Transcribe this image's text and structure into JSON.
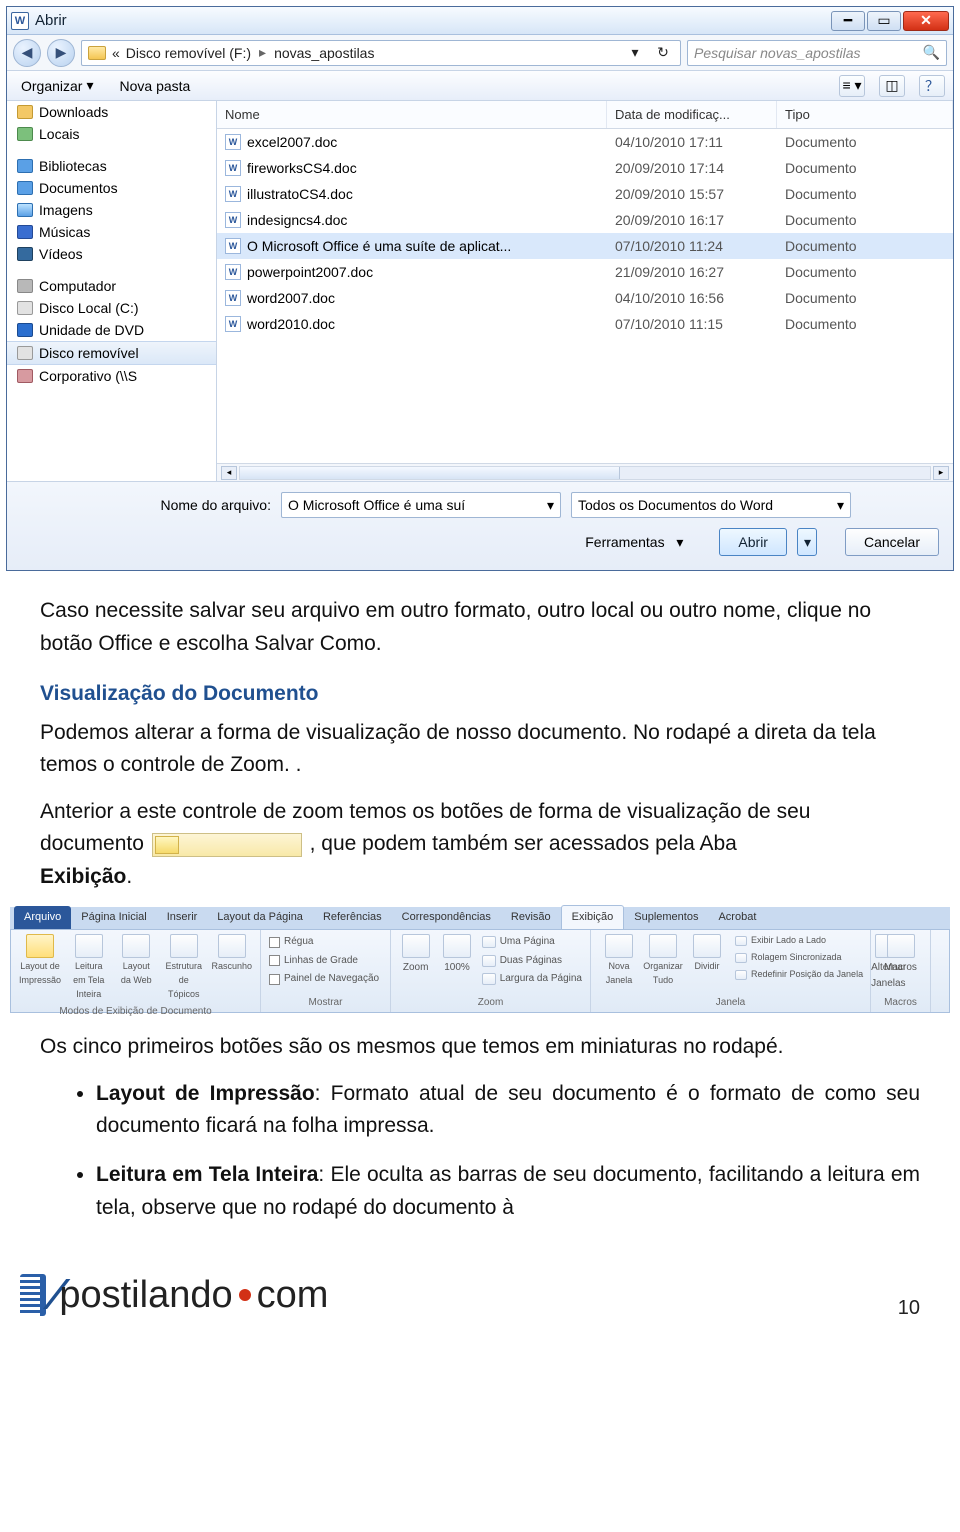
{
  "dialog": {
    "title": "Abrir",
    "breadcrumb": {
      "prefix": "«",
      "drive": "Disco removível (F:)",
      "folder": "novas_apostilas"
    },
    "search_placeholder": "Pesquisar novas_apostilas",
    "toolbar": {
      "organize": "Organizar",
      "new_folder": "Nova pasta"
    },
    "tree": [
      {
        "label": "Downloads",
        "icon": "yellow"
      },
      {
        "label": "Locais",
        "icon": "green"
      },
      {
        "label": "Bibliotecas",
        "icon": "blue",
        "group": true
      },
      {
        "label": "Documentos",
        "icon": "blue"
      },
      {
        "label": "Imagens",
        "icon": "pictures"
      },
      {
        "label": "Músicas",
        "icon": "music"
      },
      {
        "label": "Vídeos",
        "icon": "video"
      },
      {
        "label": "Computador",
        "icon": "gray",
        "group": true
      },
      {
        "label": "Disco Local (C:)",
        "icon": "drive"
      },
      {
        "label": "Unidade de DVD",
        "icon": "dvd"
      },
      {
        "label": "Disco removível",
        "icon": "drive",
        "selected": true
      },
      {
        "label": "Corporativo (\\\\S",
        "icon": "net"
      }
    ],
    "columns": {
      "name": "Nome",
      "date": "Data de modificaç...",
      "type": "Tipo"
    },
    "files": [
      {
        "name": "excel2007.doc",
        "date": "04/10/2010 17:11",
        "type": "Documento "
      },
      {
        "name": "fireworksCS4.doc",
        "date": "20/09/2010 17:14",
        "type": "Documento "
      },
      {
        "name": "illustratoCS4.doc",
        "date": "20/09/2010 15:57",
        "type": "Documento "
      },
      {
        "name": "indesigncs4.doc",
        "date": "20/09/2010 16:17",
        "type": "Documento "
      },
      {
        "name": "O Microsoft Office é uma suíte de aplicat...",
        "date": "07/10/2010 11:24",
        "type": "Documento ",
        "selected": true
      },
      {
        "name": "powerpoint2007.doc",
        "date": "21/09/2010 16:27",
        "type": "Documento "
      },
      {
        "name": "word2007.doc",
        "date": "04/10/2010 16:56",
        "type": "Documento "
      },
      {
        "name": "word2010.doc",
        "date": "07/10/2010 11:15",
        "type": "Documento "
      }
    ],
    "filename_label": "Nome do arquivo:",
    "filename_value": "O Microsoft Office é uma suí",
    "filter_value": "Todos os Documentos do Word",
    "tools": "Ferramentas",
    "open": "Abrir",
    "cancel": "Cancelar"
  },
  "article": {
    "p1": "Caso necessite salvar seu arquivo em outro formato, outro local ou outro nome, clique no botão Office e escolha Salvar Como.",
    "h2": "Visualização do Documento",
    "p2": "Podemos alterar a forma de visualização de nosso documento. No rodapé a direta da tela temos o controle de Zoom. .",
    "p3a": "Anterior a este controle de zoom temos os botões de forma de visualização de seu documento ",
    "p3b": ", que podem também ser acessados pela Aba ",
    "p3_strong": "Exibição",
    "p3c": ".",
    "p4": "Os cinco primeiros botões são os mesmos que temos em miniaturas no rodapé.",
    "bul1_strong": "Layout de Impressão",
    "bul1": ": Formato atual de seu documento é o formato de como seu documento ficará na folha impressa.",
    "bul2_strong": "Leitura em Tela Inteira",
    "bul2": ": Ele oculta as barras de seu documento, facilitando a leitura em tela, observe que no rodapé do documento à"
  },
  "ribbon": {
    "tabs": [
      "Arquivo",
      "Página Inicial",
      "Inserir",
      "Layout da Página",
      "Referências",
      "Correspondências",
      "Revisão",
      "Exibição",
      "Suplementos",
      "Acrobat"
    ],
    "active_tab": 7,
    "group_views": {
      "name": "Modos de Exibição de Documento",
      "items": [
        "Layout de Impressão",
        "Leitura em Tela Inteira",
        "Layout da Web",
        "Estrutura de Tópicos",
        "Rascunho"
      ]
    },
    "group_show": {
      "name": "Mostrar",
      "items": [
        "Régua",
        "Linhas de Grade",
        "Painel de Navegação"
      ]
    },
    "group_zoom": {
      "name": "Zoom",
      "zoom": "Zoom",
      "pct": "100%",
      "items": [
        "Uma Página",
        "Duas Páginas",
        "Largura da Página"
      ]
    },
    "group_window": {
      "name": "Janela",
      "items": [
        "Nova Janela",
        "Organizar Tudo",
        "Dividir"
      ],
      "side": [
        "Exibir Lado a Lado",
        "Rolagem Sincronizada",
        "Redefinir Posição da Janela"
      ],
      "switch": "Alternar Janelas"
    },
    "group_macros": {
      "name": "Macros",
      "label": "Macros"
    }
  },
  "footer": {
    "brand_a": "postilando",
    "brand_b": "com",
    "page": "10"
  }
}
